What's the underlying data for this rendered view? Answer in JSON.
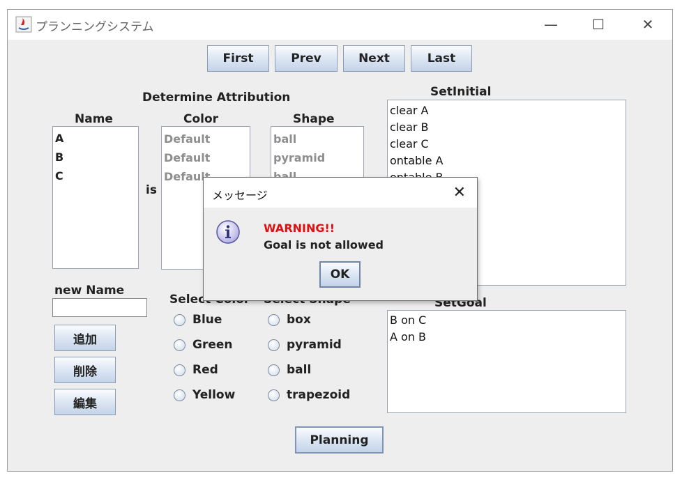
{
  "window": {
    "title": "プランニングシステム",
    "minimize": "—",
    "maximize": "☐",
    "close": "✕"
  },
  "nav": {
    "first": "First",
    "prev": "Prev",
    "next": "Next",
    "last": "Last"
  },
  "attribution": {
    "heading": "Determine Attribution",
    "name_label": "Name",
    "color_label": "Color",
    "shape_label": "Shape",
    "is_label": "is",
    "names": [
      "A",
      "B",
      "C"
    ],
    "colors": [
      "Default",
      "Default",
      "Default"
    ],
    "shapes": [
      "ball",
      "pyramid",
      "ball"
    ]
  },
  "new_name": {
    "label": "new Name",
    "value": ""
  },
  "actions": {
    "add": "追加",
    "delete": "削除",
    "edit": "編集"
  },
  "select_color": {
    "label": "Select Color",
    "options": [
      "Blue",
      "Green",
      "Red",
      "Yellow"
    ]
  },
  "select_shape": {
    "label": "Select Shape",
    "options": [
      "box",
      "pyramid",
      "ball",
      "trapezoid"
    ]
  },
  "set_initial": {
    "label": "SetInitial",
    "items": [
      "clear A",
      "clear B",
      "clear C",
      "ontable A",
      "ontable B"
    ]
  },
  "set_goal": {
    "label": "SetGoal",
    "items": [
      "B on C",
      "A on B"
    ]
  },
  "planning_button": "Planning",
  "dialog": {
    "title": "メッセージ",
    "warning": "WARNING!!",
    "message": "Goal is not allowed",
    "ok": "OK",
    "close": "✕",
    "icon": "info-icon"
  }
}
